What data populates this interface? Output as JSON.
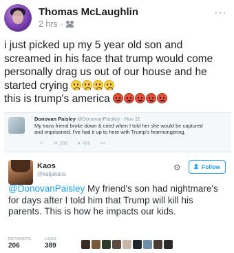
{
  "post": {
    "author": "Thomas McLaughlin",
    "time": "2 hrs",
    "separator": "·",
    "audience_icon": "friends-icon",
    "more": "···",
    "text_line1": "i just picked up my 5 year old son and screamed in his face that trump would come personally drag us out of our house and he started crying",
    "text_line2": "this is trump's america"
  },
  "tweet_quoted": {
    "name": "Donovan Paisley",
    "handle": "@DonovanPaisley",
    "date": "· Nov 11",
    "text": "My trans friend broke down & cried when I told her she would be captured and imprisoned. I've had it up to here with Trump's fearmongering.",
    "retweets": "286",
    "likes": "486"
  },
  "tweet_main": {
    "name": "Kaos",
    "handle": "@katjakaos",
    "follow_label": "Follow",
    "mention": "@DonovanPaisley",
    "text": " My friend's son had nightmare's for days after I told him that Trump will kill his parents. This is how he impacts our kids.",
    "retweets_label": "RETWEETS",
    "retweets": "206",
    "likes_label": "LIKES",
    "likes": "389"
  },
  "colors": {
    "twitter_blue": "#1da1f2",
    "fb_text": "#1c1e21",
    "fb_meta": "#8d949e",
    "liker_colors": [
      "#3b2b22",
      "#7a5a3a",
      "#2e3c2a",
      "#5d4a3e",
      "#c8b6a6",
      "#1f2630",
      "#6f8fa6",
      "#4a3a34",
      "#2b2b2b"
    ]
  }
}
